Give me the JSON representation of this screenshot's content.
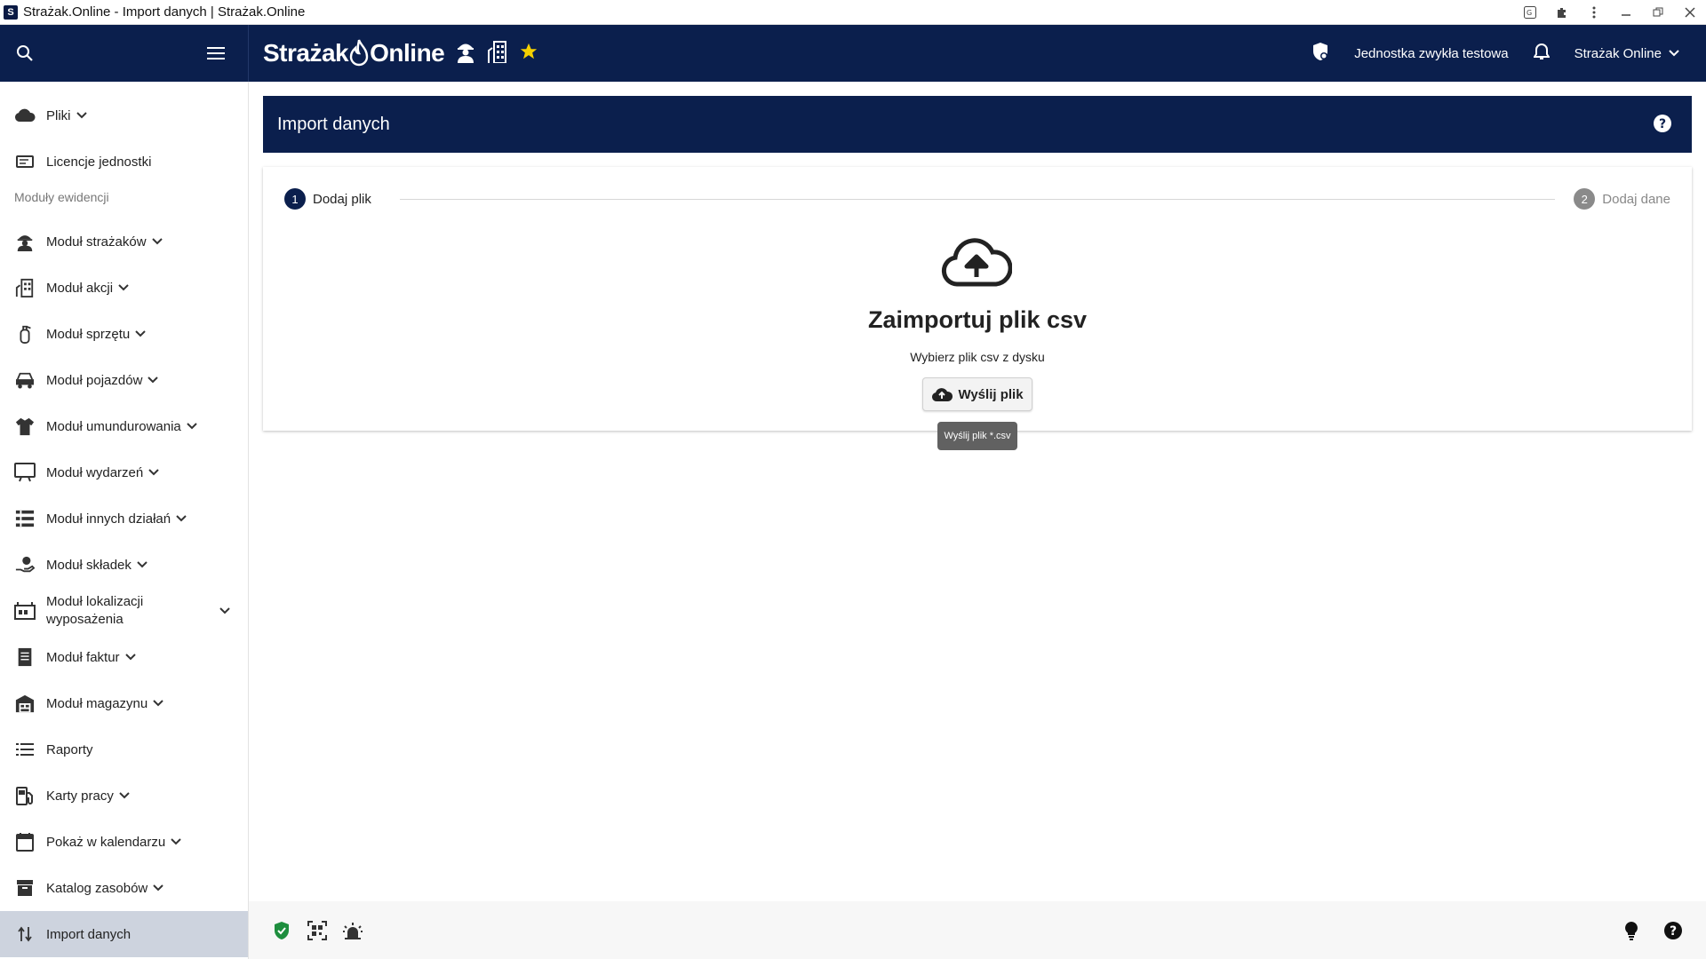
{
  "window": {
    "title": "Strażak.Online - Import danych | Strażak.Online",
    "app_icon": "app-logo-icon",
    "controls": [
      "translate-icon",
      "extensions-icon",
      "more-vert-icon",
      "minimize-icon",
      "restore-icon",
      "close-icon"
    ]
  },
  "header": {
    "logo_text_left": "Strażak",
    "logo_text_right": "Online",
    "unit_name": "Jednostka zwykła testowa",
    "user_name": "Strażak Online",
    "colors": {
      "header_bg": "#0b1f4d",
      "star": "#f5d000"
    }
  },
  "sidebar": {
    "items": [
      {
        "label": "Pliki",
        "icon": "cloud-icon",
        "has_chevron": true
      },
      {
        "label": "Licencje jednostki",
        "icon": "license-icon",
        "has_chevron": false
      }
    ],
    "section_label": "Moduły ewidencji",
    "modules": [
      {
        "label": "Moduł strażaków",
        "icon": "firefighter-icon"
      },
      {
        "label": "Moduł akcji",
        "icon": "building-fire-icon"
      },
      {
        "label": "Moduł sprzętu",
        "icon": "extinguisher-icon"
      },
      {
        "label": "Moduł pojazdów",
        "icon": "vehicle-icon"
      },
      {
        "label": "Moduł umundurowania",
        "icon": "uniform-icon"
      },
      {
        "label": "Moduł wydarzeń",
        "icon": "events-icon"
      },
      {
        "label": "Moduł innych działań",
        "icon": "activities-icon"
      },
      {
        "label": "Moduł składek",
        "icon": "fees-icon"
      },
      {
        "label": "Moduł lokalizacji wyposażenia",
        "icon": "equipment-location-icon"
      },
      {
        "label": "Moduł faktur",
        "icon": "invoice-icon"
      },
      {
        "label": "Moduł magazynu",
        "icon": "warehouse-icon"
      },
      {
        "label": "Raporty",
        "icon": "list-icon",
        "no_chevron": true
      },
      {
        "label": "Karty pracy",
        "icon": "fuel-card-icon"
      },
      {
        "label": "Pokaż w kalendarzu",
        "icon": "calendar-icon"
      },
      {
        "label": "Katalog zasobów",
        "icon": "archive-icon"
      },
      {
        "label": "Import danych",
        "icon": "import-arrows-icon",
        "active": true,
        "no_chevron": true
      }
    ]
  },
  "page": {
    "title": "Import danych",
    "stepper": {
      "steps": [
        {
          "number": "1",
          "label": "Dodaj plik",
          "active": true
        },
        {
          "number": "2",
          "label": "Dodaj dane",
          "active": false
        }
      ]
    },
    "upload": {
      "heading": "Zaimportuj plik csv",
      "subheading": "Wybierz plik csv z dysku",
      "button_label": "Wyślij plik",
      "tooltip": "Wyślij plik *.csv"
    }
  },
  "footer": {
    "left_icons": [
      "shield-check-icon",
      "qr-scan-icon",
      "siren-icon"
    ],
    "right_icons": [
      "lightbulb-icon",
      "help-icon"
    ],
    "colors": {
      "shield": "#1e8e3e"
    }
  }
}
